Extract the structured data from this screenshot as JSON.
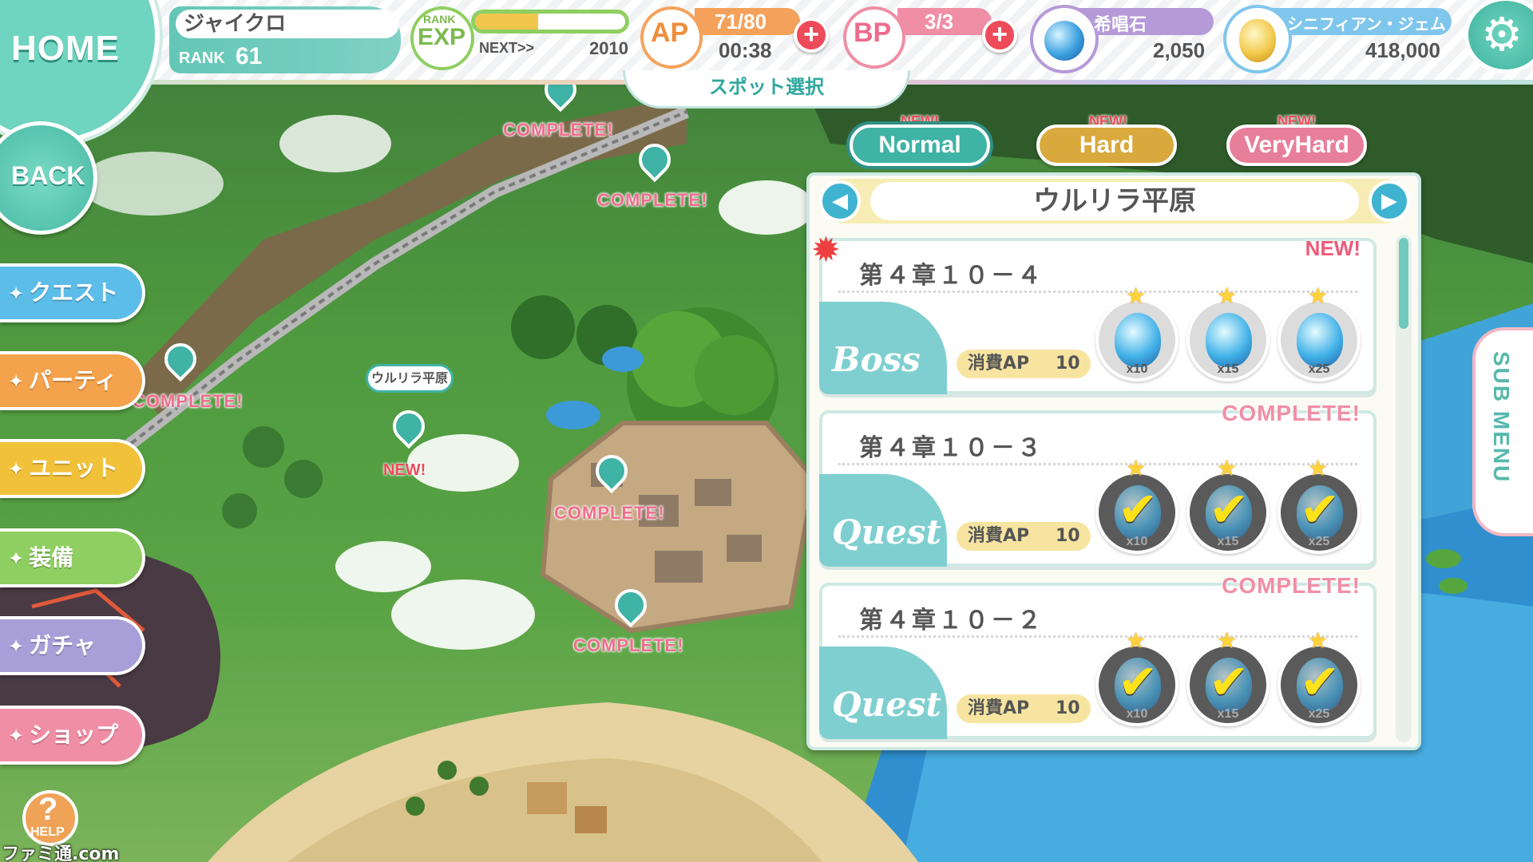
{
  "header": {
    "home_label": "HOME",
    "back_label": "BACK",
    "player_name": "ジャイクロ",
    "rank_label": "RANK",
    "rank_value": "61",
    "exp_small": "RANK",
    "exp_label": "EXP",
    "exp_progress": 0.42,
    "next_label": "NEXT>>",
    "next_value": "2010",
    "ap_label": "AP",
    "ap_value": "71/80",
    "ap_timer": "00:38",
    "bp_label": "BP",
    "bp_value": "3/3",
    "stone_label": "希唱石",
    "stone_value": "2,050",
    "gem_label": "シニフィアン・ジェム",
    "gem_value": "418,000",
    "settings_icon": "gear-icon",
    "spot_select": "スポット選択"
  },
  "side_menu": [
    {
      "label": "クエスト",
      "color": "#5cbde8"
    },
    {
      "label": "パーティ",
      "color": "#f4a24b"
    },
    {
      "label": "ユニット",
      "color": "#f2c13a"
    },
    {
      "label": "装備",
      "color": "#8fcf61"
    },
    {
      "label": "ガチャ",
      "color": "#a89ed8"
    },
    {
      "label": "ショップ",
      "color": "#f08ea5"
    }
  ],
  "help": {
    "symbol": "?",
    "label": "HELP"
  },
  "watermark": "ファミ通.com",
  "difficulty": {
    "new_label": "NEW!",
    "tabs": [
      {
        "label": "Normal",
        "color": "#3fb3a5",
        "selected": true
      },
      {
        "label": "Hard",
        "color": "#d9a93e",
        "selected": false
      },
      {
        "label": "VeryHard",
        "color": "#e87f9a",
        "selected": false
      }
    ]
  },
  "panel": {
    "area_name": "ウルリラ平原",
    "prev_icon": "arrow-left-icon",
    "next_icon": "arrow-right-icon",
    "cost_label": "消費AP",
    "quests": [
      {
        "title": "第４章１０－４",
        "badge": "Boss",
        "status": "NEW!",
        "cost": "10",
        "rewards": [
          {
            "mult": "x10",
            "done": false
          },
          {
            "mult": "x15",
            "done": false
          },
          {
            "mult": "x25",
            "done": false
          }
        ]
      },
      {
        "title": "第４章１０－３",
        "badge": "Quest",
        "status": "COMPLETE!",
        "cost": "10",
        "rewards": [
          {
            "mult": "x10",
            "done": true
          },
          {
            "mult": "x15",
            "done": true
          },
          {
            "mult": "x25",
            "done": true
          }
        ]
      },
      {
        "title": "第４章１０－２",
        "badge": "Quest",
        "status": "COMPLETE!",
        "cost": "10",
        "rewards": [
          {
            "mult": "x10",
            "done": true
          },
          {
            "mult": "x15",
            "done": true
          },
          {
            "mult": "x25",
            "done": true
          }
        ]
      }
    ]
  },
  "submenu_label": "SUB MENU",
  "map": {
    "complete_label": "COMPLETE!",
    "selected_spot": "ウルリラ平原",
    "new_label": "NEW!"
  }
}
